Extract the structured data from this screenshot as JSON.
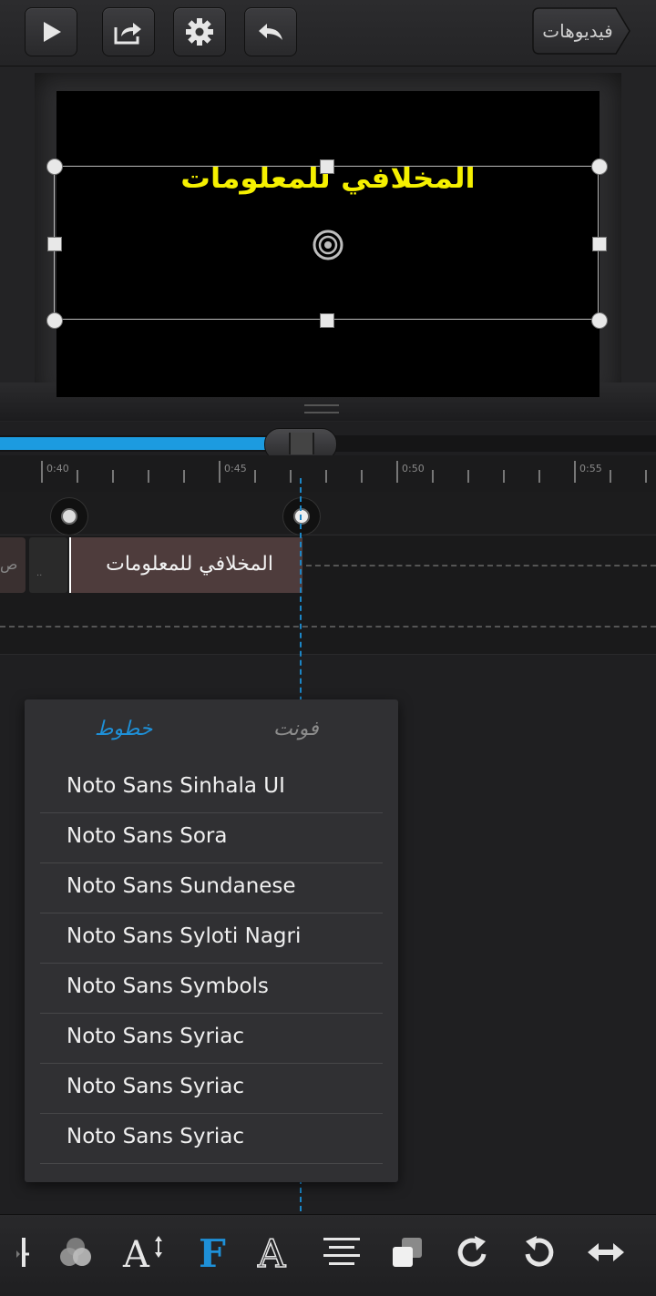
{
  "toolbar": {
    "back_label": "فيديوهات",
    "play_icon": "play-icon",
    "share_icon": "share-icon",
    "settings_icon": "gear-icon",
    "undo_icon": "undo-icon"
  },
  "preview": {
    "title_text": "المخلافي للمعلومات"
  },
  "playback": {
    "progress": 0.42
  },
  "ruler": {
    "labels": [
      "0:40",
      "0:45",
      "0:50",
      "0:55"
    ]
  },
  "timeline": {
    "clip_prev_label": "ص",
    "clip_short_label": "..",
    "clip_main_label": "المخلافي للمعلومات"
  },
  "font_popup": {
    "tab_fonts": "فونت",
    "tab_lines": "خطوط",
    "items": [
      "Noto  Sans  Sinhala  UI",
      "Noto Sans Sora",
      "Noto Sans Sundanese",
      "Noto Sans Syloti Nagri",
      "Noto Sans Symbols",
      "Noto Sans Syriac",
      "Noto Sans Syriac",
      "Noto Sans Syriac"
    ]
  },
  "bottom_toolbar": {
    "tools": [
      "split-icon",
      "blend-icon",
      "text-size-icon",
      "font-icon",
      "outline-text-icon",
      "align-icon",
      "layer-order-icon",
      "redo-icon",
      "rotate-icon",
      "flip-icon"
    ],
    "accent": "#1e90d8"
  }
}
